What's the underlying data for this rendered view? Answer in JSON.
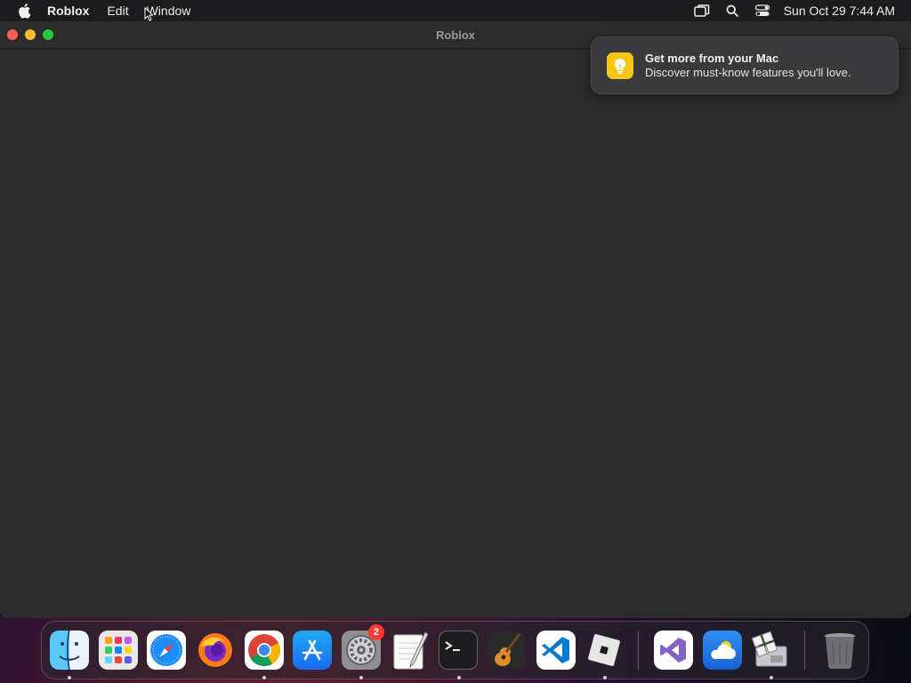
{
  "menubar": {
    "app_name": "Roblox",
    "menus": [
      "Edit",
      "Window"
    ],
    "clock": "Sun Oct 29  7:44 AM",
    "status_icons": [
      "display-mirror-icon",
      "search-icon",
      "control-center-icon"
    ]
  },
  "window": {
    "title": "Roblox"
  },
  "notification": {
    "title": "Get more from your Mac",
    "body": "Discover must-know features you'll love."
  },
  "dock": {
    "apps": [
      {
        "name": "Finder",
        "icon": "finder-icon",
        "running": true
      },
      {
        "name": "Launchpad",
        "icon": "launchpad-icon",
        "running": false
      },
      {
        "name": "Safari",
        "icon": "safari-icon",
        "running": false
      },
      {
        "name": "Firefox",
        "icon": "firefox-icon",
        "running": false
      },
      {
        "name": "Google Chrome",
        "icon": "chrome-icon",
        "running": true
      },
      {
        "name": "App Store",
        "icon": "app-store-icon",
        "running": false
      },
      {
        "name": "System Settings",
        "icon": "settings-icon",
        "running": true,
        "badge": "2"
      },
      {
        "name": "TextEdit",
        "icon": "textedit-icon",
        "running": false
      },
      {
        "name": "Terminal",
        "icon": "terminal-icon",
        "running": true
      },
      {
        "name": "GarageBand",
        "icon": "garageband-icon",
        "running": false
      },
      {
        "name": "Visual Studio Code",
        "icon": "vscode-icon",
        "running": false
      },
      {
        "name": "Roblox",
        "icon": "roblox-icon",
        "running": true
      }
    ],
    "recent": [
      {
        "name": "Visual Studio",
        "icon": "visual-studio-icon",
        "running": false
      },
      {
        "name": "Weather",
        "icon": "weather-icon",
        "running": false
      },
      {
        "name": "Boot Camp Assistant",
        "icon": "bootcamp-icon",
        "running": true
      }
    ],
    "trash": {
      "name": "Trash",
      "icon": "trash-icon"
    }
  }
}
